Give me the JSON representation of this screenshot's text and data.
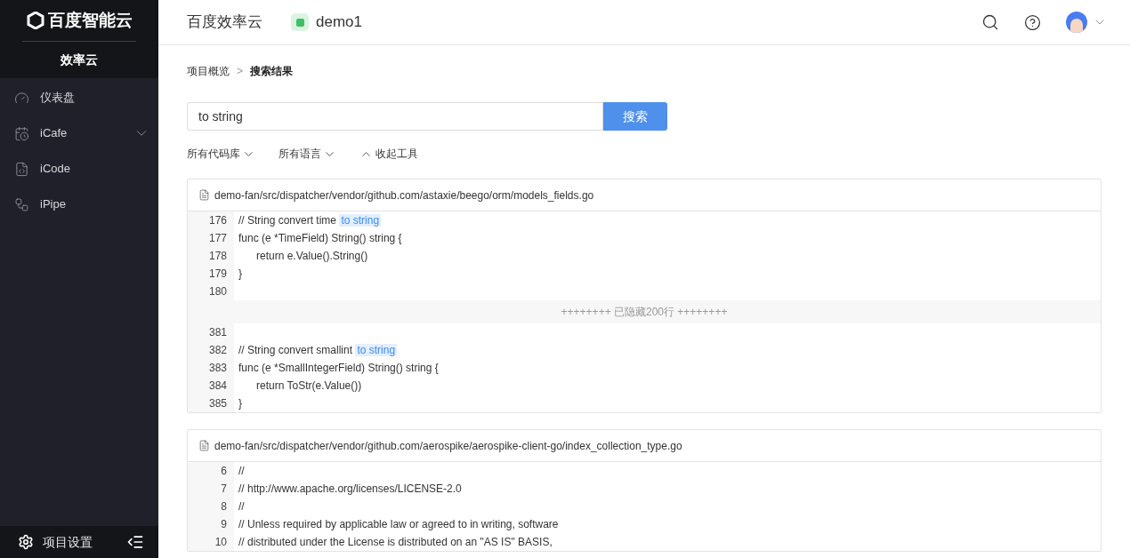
{
  "sidebar": {
    "logo": "百度智能云",
    "product": "效率云",
    "items": [
      {
        "label": "仪表盘",
        "expandable": false
      },
      {
        "label": "iCafe",
        "expandable": true
      },
      {
        "label": "iCode",
        "expandable": false
      },
      {
        "label": "iPipe",
        "expandable": false
      }
    ],
    "footer": {
      "label": "项目设置"
    }
  },
  "header": {
    "title": "百度效率云",
    "project": "demo1"
  },
  "breadcrumb": [
    {
      "label": "项目概览",
      "current": false
    },
    {
      "label": "搜索结果",
      "current": true
    }
  ],
  "breadcrumb_separator": ">",
  "search": {
    "value": "to string",
    "button": "搜索"
  },
  "filters": [
    {
      "label": "所有代码库",
      "kind": "dropdown"
    },
    {
      "label": "所有语言",
      "kind": "dropdown"
    },
    {
      "label": "收起工具",
      "kind": "collapse"
    }
  ],
  "results": [
    {
      "path": "demo-fan/src/dispatcher/vendor/github.com/astaxie/beego/orm/models_fields.go",
      "rows": [
        {
          "kind": "line",
          "number": "176",
          "segments": [
            {
              "text": "// String convert time ",
              "match": false
            },
            {
              "text": "to string",
              "match": true
            }
          ]
        },
        {
          "kind": "line",
          "number": "177",
          "segments": [
            {
              "text": "func (e *TimeField) String() string {",
              "match": false
            }
          ]
        },
        {
          "kind": "line",
          "number": "178",
          "segments": [
            {
              "text": "\treturn e.Value().String()",
              "match": false
            }
          ]
        },
        {
          "kind": "line",
          "number": "179",
          "segments": [
            {
              "text": "}",
              "match": false
            }
          ]
        },
        {
          "kind": "line",
          "number": "180",
          "segments": []
        },
        {
          "kind": "hidden",
          "label": "++++++++ 已隐藏200行 ++++++++"
        },
        {
          "kind": "line",
          "number": "381",
          "segments": []
        },
        {
          "kind": "line",
          "number": "382",
          "segments": [
            {
              "text": "// String convert smallint ",
              "match": false
            },
            {
              "text": "to string",
              "match": true
            }
          ]
        },
        {
          "kind": "line",
          "number": "383",
          "segments": [
            {
              "text": "func (e *SmallIntegerField) String() string {",
              "match": false
            }
          ]
        },
        {
          "kind": "line",
          "number": "384",
          "segments": [
            {
              "text": "\treturn ToStr(e.Value())",
              "match": false
            }
          ]
        },
        {
          "kind": "line",
          "number": "385",
          "segments": [
            {
              "text": "}",
              "match": false
            }
          ]
        }
      ]
    },
    {
      "path": "demo-fan/src/dispatcher/vendor/github.com/aerospike/aerospike-client-go/index_collection_type.go",
      "rows": [
        {
          "kind": "line",
          "number": "6",
          "segments": [
            {
              "text": "//",
              "match": false
            }
          ]
        },
        {
          "kind": "line",
          "number": "7",
          "segments": [
            {
              "text": "// http://www.apache.org/licenses/LICENSE-2.0",
              "match": false
            }
          ]
        },
        {
          "kind": "line",
          "number": "8",
          "segments": [
            {
              "text": "//",
              "match": false
            }
          ]
        },
        {
          "kind": "line",
          "number": "9",
          "segments": [
            {
              "text": "// Unless required by applicable law or agreed to in writing, software",
              "match": false
            }
          ]
        },
        {
          "kind": "line",
          "number": "10",
          "segments": [
            {
              "text": "// distributed under the License is distributed on an \"AS IS\" BASIS,",
              "match": false
            }
          ]
        }
      ]
    }
  ]
}
